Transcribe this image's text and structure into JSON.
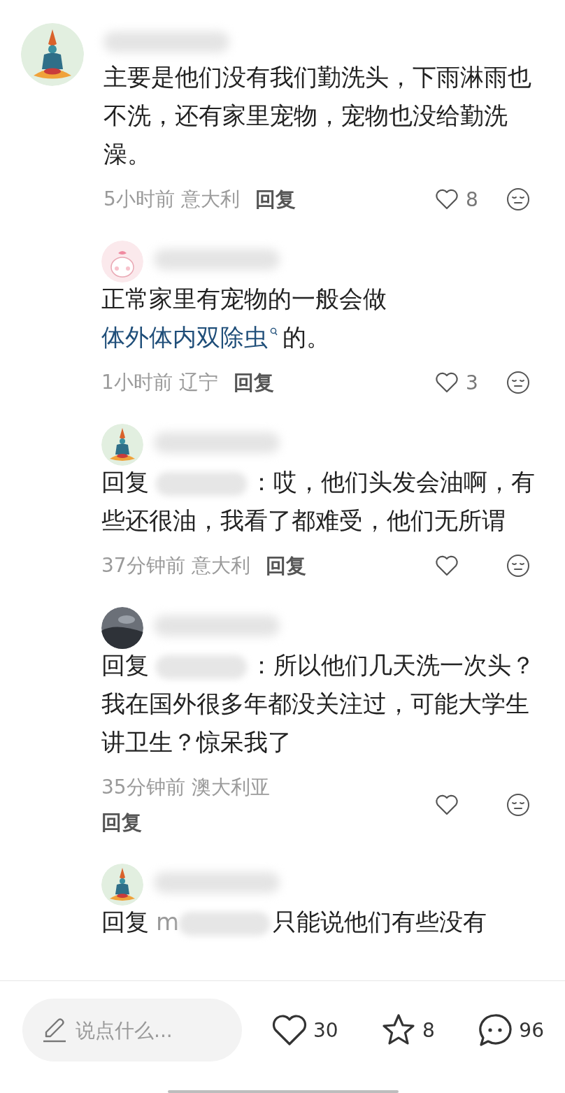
{
  "comments": [
    {
      "kind": "top",
      "body": [
        {
          "kind": "text",
          "text": "主要是他们没有我们勤洗头，下雨淋雨也不洗，还有家里宠物，宠物也没给勤洗澡。"
        }
      ],
      "time": "5小时前",
      "location": "意大利",
      "reply_action": "回复",
      "likes": "8"
    },
    {
      "kind": "reply",
      "body": [
        {
          "kind": "text",
          "text": "正常家里有宠物的一般会做 "
        },
        {
          "kind": "link",
          "text": "体外体内双除虫"
        },
        {
          "kind": "text",
          "text": "的。"
        }
      ],
      "time": "1小时前",
      "location": "辽宁",
      "reply_action": "回复",
      "likes": "3"
    },
    {
      "kind": "reply",
      "reply_label": "回复",
      "body": [
        {
          "kind": "text",
          "text": "：哎，他们头发会油啊，有些还很油，我看了都难受，他们无所谓"
        }
      ],
      "time": "37分钟前",
      "location": "意大利",
      "reply_action": "回复"
    },
    {
      "kind": "reply",
      "reply_label": "回复",
      "body": [
        {
          "kind": "text",
          "text": "：所以他们几天洗一次头？我在国外很多年都没关注过，可能大学生讲卫生？惊呆我了"
        }
      ],
      "time": "35分钟前",
      "location": "澳大利亚",
      "reply_action": "回复"
    },
    {
      "kind": "reply",
      "reply_label": "回复",
      "mention": "m",
      "body": [
        {
          "kind": "text",
          "text": "只能说他们有些没有"
        }
      ]
    }
  ],
  "composer": {
    "placeholder": "说点什么..."
  },
  "actions": [
    {
      "kind": "like",
      "count": "30"
    },
    {
      "kind": "favorite",
      "count": "8"
    },
    {
      "kind": "comment",
      "count": "96"
    }
  ]
}
